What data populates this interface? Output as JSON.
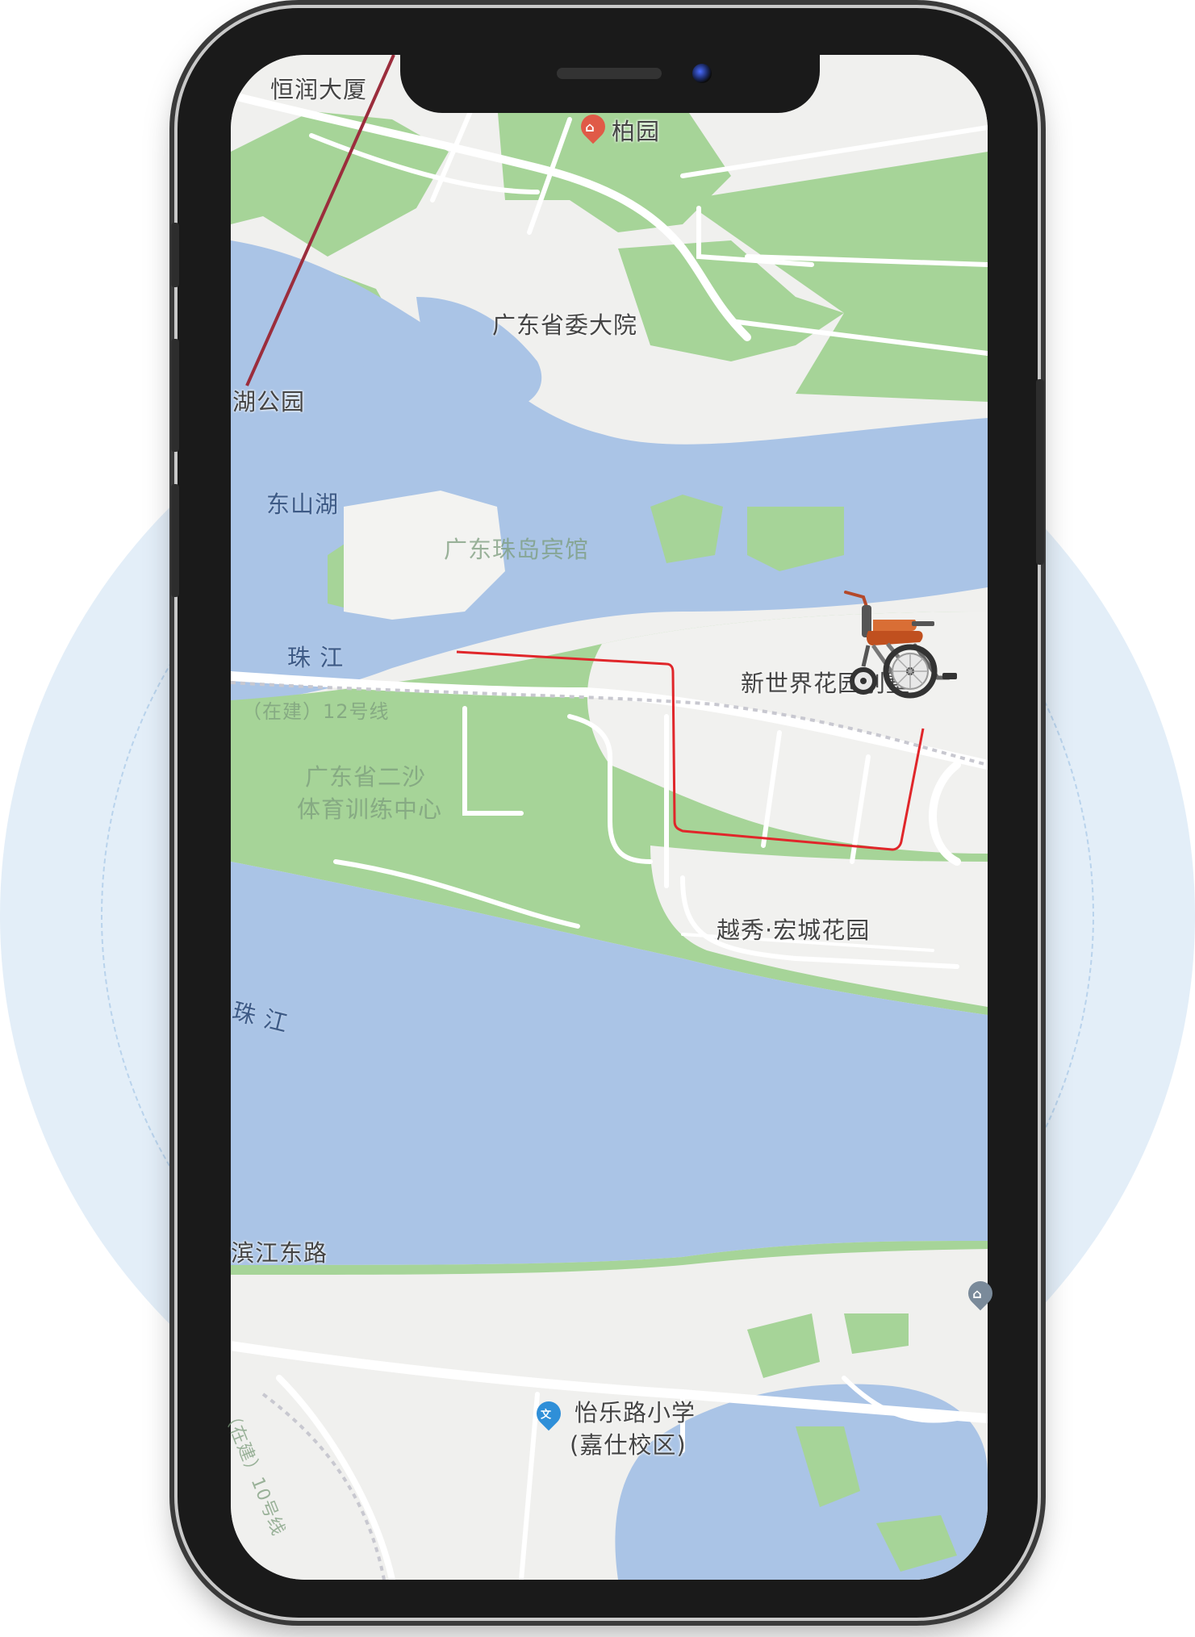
{
  "map": {
    "labels": [
      {
        "id": "hengrun",
        "text": "恒润大厦"
      },
      {
        "id": "baiyuan",
        "text": "柏园"
      },
      {
        "id": "party-compound",
        "text": "广东省委大院"
      },
      {
        "id": "park",
        "text": "湖公园"
      },
      {
        "id": "dongshan-lake",
        "text": "东山湖"
      },
      {
        "id": "zhudao-hotel",
        "text": "广东珠岛宾馆"
      },
      {
        "id": "pearl-river-1",
        "text": "珠 江"
      },
      {
        "id": "metro-line",
        "text": "（在建）12号线"
      },
      {
        "id": "new-world",
        "text": "新世界花园别墅"
      },
      {
        "id": "ersha-sports-1",
        "text": "广东省二沙"
      },
      {
        "id": "ersha-sports-2",
        "text": "体育训练中心"
      },
      {
        "id": "hongcheng",
        "text": "越秀·宏城花园"
      },
      {
        "id": "pearl-river-2",
        "text": "珠 江"
      },
      {
        "id": "binjiang-road",
        "text": "滨江东路"
      },
      {
        "id": "school-1",
        "text": "怡乐路小学"
      },
      {
        "id": "school-2",
        "text": "(嘉仕校区)"
      },
      {
        "id": "metro-line-2",
        "text": "（在建）10号线"
      }
    ],
    "poi_icons": [
      {
        "id": "baiyuan-pin",
        "icon": "house-pin-icon",
        "color": "#e05a47",
        "glyph": "⌂"
      },
      {
        "id": "school-pin",
        "icon": "school-pin-icon",
        "color": "#2f8fd8",
        "glyph": "文"
      },
      {
        "id": "edge-pin",
        "icon": "poi-pin-icon",
        "color": "#7a8a9a",
        "glyph": "⌂"
      }
    ],
    "marker": {
      "icon": "wheelchair-icon",
      "frame_color": "#c0501f"
    },
    "route": {
      "color": "#e0262a"
    },
    "colors": {
      "water": "#aac4e6",
      "green": "#a6d498",
      "land": "#f0f0ee",
      "road": "#ffffff",
      "metro": "#9b2d3c"
    }
  }
}
